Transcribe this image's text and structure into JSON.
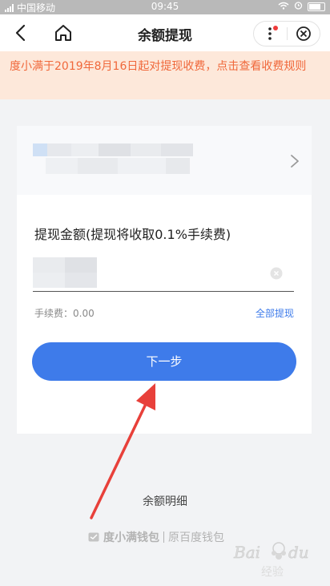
{
  "status_bar": {
    "carrier": "中国移动",
    "time": "09:45"
  },
  "nav": {
    "title": "余额提现"
  },
  "notice": {
    "text": "度小满于2019年8月16日起对提现收费，点击查看收费规则"
  },
  "amount": {
    "label": "提现金额(提现将收取0.1%手续费)",
    "fee_text": "手续费：0.00",
    "withdraw_all": "全部提现"
  },
  "next_button": {
    "label": "下一步"
  },
  "detail_link": "余额明细",
  "footer": {
    "brand": "度小满钱包",
    "former": "原百度钱包"
  },
  "watermark": {
    "text": "Bai du 经验"
  },
  "colors": {
    "accent": "#3e7bea",
    "notice_bg": "#fde8da",
    "notice_text": "#f0683b",
    "arrow": "#e8403a"
  },
  "icons": [
    "back-icon",
    "home-icon",
    "more-icon",
    "close-circle-icon",
    "chevron-right-icon",
    "clear-icon",
    "wallet-icon"
  ]
}
